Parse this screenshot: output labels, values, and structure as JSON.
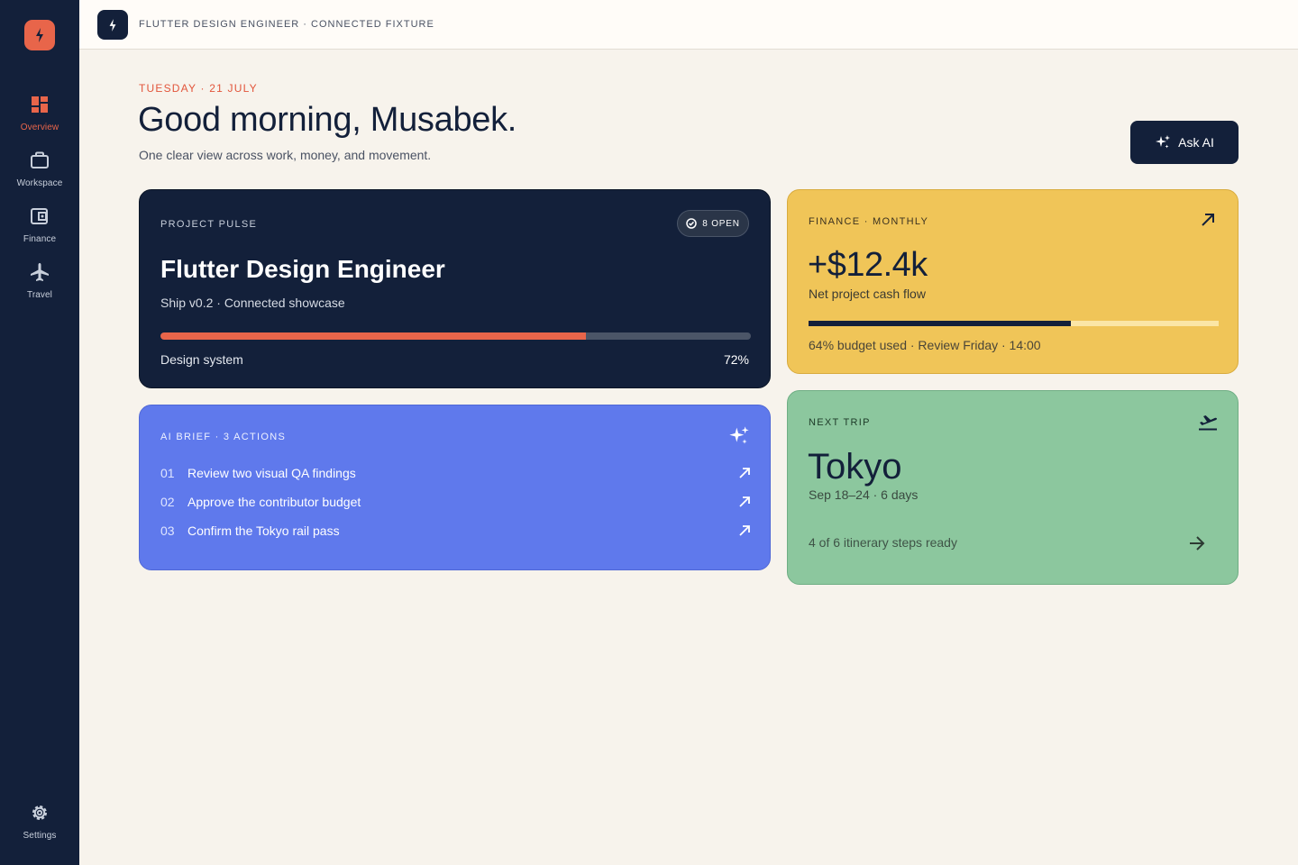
{
  "sidebar": {
    "logo_icon": "bolt-icon",
    "items": [
      {
        "label": "Overview",
        "icon": "dashboard-icon",
        "active": true
      },
      {
        "label": "Workspace",
        "icon": "briefcase-icon",
        "active": false
      },
      {
        "label": "Finance",
        "icon": "wallet-icon",
        "active": false
      },
      {
        "label": "Travel",
        "icon": "airplane-icon",
        "active": false
      }
    ],
    "settings": {
      "label": "Settings",
      "icon": "gear-icon"
    }
  },
  "topbar": {
    "title": "FLUTTER DESIGN ENGINEER · CONNECTED FIXTURE",
    "icon": "bolt-icon"
  },
  "header": {
    "eyebrow": "TUESDAY · 21 JULY",
    "greeting": "Good morning, Musabek.",
    "subtitle": "One clear view across work, money, and movement.",
    "ask_button": "Ask AI"
  },
  "pulse": {
    "label": "PROJECT PULSE",
    "chip": "8 OPEN",
    "title": "Flutter Design Engineer",
    "subtitle": "Ship v0.2 · Connected showcase",
    "progress_label": "Design system",
    "progress_text": "72%",
    "progress_value": 0.72
  },
  "finance": {
    "label": "FINANCE · MONTHLY",
    "value": "+$12.4k",
    "subtitle": "Net project cash flow",
    "budget_used": 0.64,
    "meta": "64% budget used · Review Friday · 14:00"
  },
  "brief": {
    "label": "AI BRIEF · 3 ACTIONS",
    "items": [
      {
        "num": "01",
        "text": "Review two visual QA findings"
      },
      {
        "num": "02",
        "text": "Approve the contributor budget"
      },
      {
        "num": "03",
        "text": "Confirm the Tokyo rail pass"
      }
    ]
  },
  "trip": {
    "label": "NEXT TRIP",
    "city": "Tokyo",
    "dates": "Sep 18–24 · 6 days",
    "meta": "4 of 6 itinerary steps ready"
  },
  "colors": {
    "navy": "#13203a",
    "accent": "#e8654a",
    "finance_card": "#f0c558",
    "brief_card": "#5f79ec",
    "trip_card": "#8cc79e",
    "background": "#f7f3ec"
  }
}
